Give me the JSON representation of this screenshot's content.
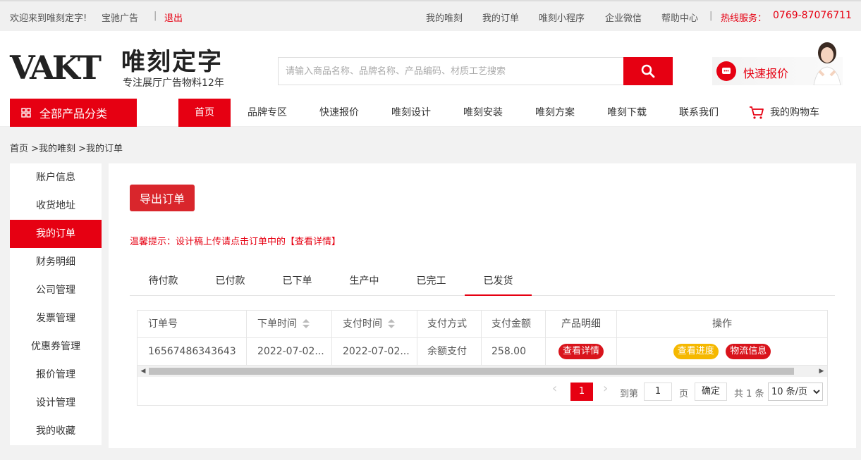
{
  "topbar": {
    "welcome": "欢迎来到唯刻定字!",
    "user": "宝驰广告",
    "sep": "|",
    "logout": "退出",
    "links": [
      "我的唯刻",
      "我的订单",
      "唯刻小程序",
      "企业微信",
      "帮助中心"
    ],
    "hotline_label": "热线服务：",
    "hotline": "0769-87076711"
  },
  "header": {
    "logo_mark": "VAKT",
    "brand": "唯刻定字",
    "slogan": "专注展厅广告物料12年",
    "search_placeholder": "请输入商品名称、品牌名称、产品编码、材质工艺搜索",
    "quote_label": "快速报价"
  },
  "nav": {
    "all_categories": "全部产品分类",
    "items": [
      "首页",
      "品牌专区",
      "快速报价",
      "唯刻设计",
      "唯刻安装",
      "唯刻方案",
      "唯刻下载",
      "联系我们"
    ],
    "cart": "我的购物车"
  },
  "breadcrumb": "首页 >我的唯刻 >我的订单",
  "sidebar": {
    "items": [
      "账户信息",
      "收货地址",
      "我的订单",
      "财务明细",
      "公司管理",
      "发票管理",
      "优惠券管理",
      "报价管理",
      "设计管理",
      "我的收藏"
    ],
    "active_index": 2
  },
  "main": {
    "export_label": "导出订单",
    "tip": "温馨提示：设计稿上传请点击订单中的【查看详情】",
    "tabs": [
      "待付款",
      "已付款",
      "已下单",
      "生产中",
      "已完工",
      "已发货"
    ],
    "active_tab": 5,
    "table": {
      "headers": [
        "订单号",
        "下单时间",
        "支付时间",
        "支付方式",
        "支付金额",
        "产品明细",
        "操作"
      ],
      "rows": [
        {
          "order_no": "16567486343643",
          "order_time": "2022-07-02...",
          "pay_time": "2022-07-02...",
          "pay_method": "余额支付",
          "amount": "258.00",
          "detail_btn": "查看详情",
          "progress_btn": "查看进度",
          "logistics_btn": "物流信息"
        }
      ]
    },
    "pager": {
      "current": "1",
      "goto_label": "到第",
      "goto_value": "1",
      "page_unit": "页",
      "confirm": "确定",
      "total": "共 1 条",
      "page_size": "10 条/页"
    }
  },
  "colors": {
    "accent": "#e60012",
    "warn": "#f5b800"
  }
}
